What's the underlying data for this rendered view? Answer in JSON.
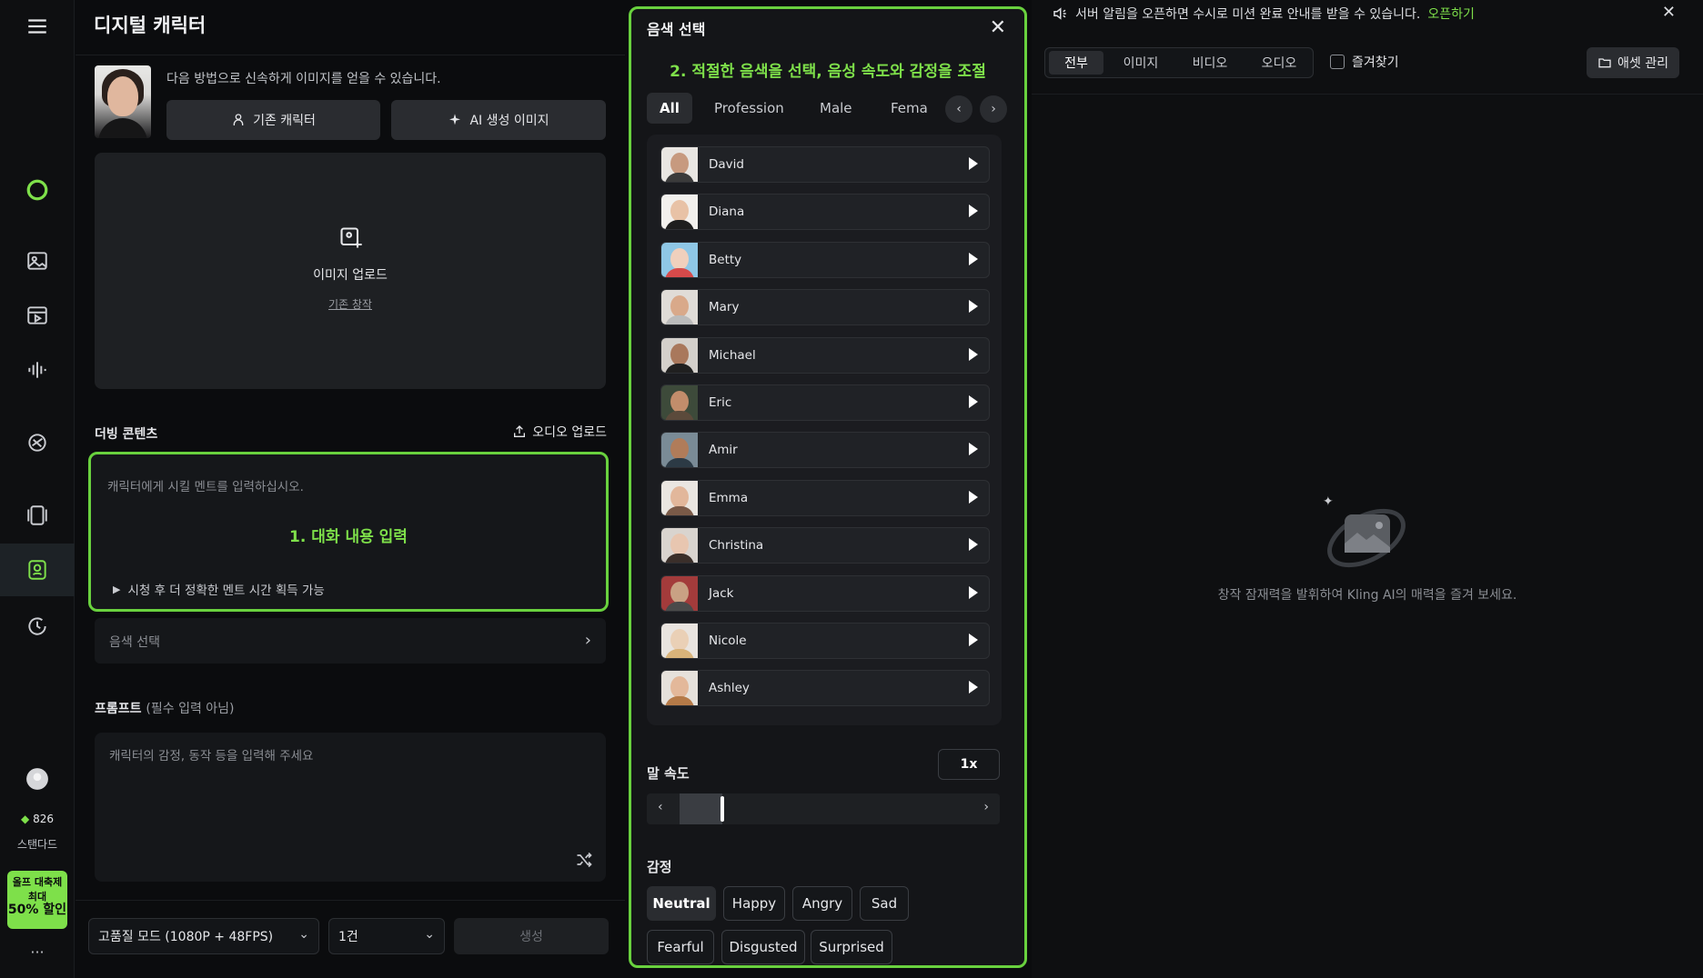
{
  "rail": {
    "credits": "826",
    "plan": "스탠다드",
    "promo": {
      "line1": "올프 대축제",
      "line2": "최대",
      "line3": "50% 할인"
    },
    "more": "···"
  },
  "left_panel": {
    "title": "디지털 캐릭터",
    "desc": "다음 방법으로 신속하게 이미지를 얻을 수 있습니다.",
    "btn_existing": "기존 캐릭터",
    "btn_ai": "AI 생성 이미지",
    "upload_label": "이미지 업로드",
    "upload_sub": "기존 창작",
    "dubbing_label": "더빙 콘텐츠",
    "audio_upload": "오디오 업로드",
    "dub_placeholder": "캐릭터에게 시킬 멘트를 입력하십시오.",
    "dub_annotation": "1. 대화 내용 입력",
    "dub_hint": "시청 후 더 정확한 멘트 시간 획득 가능",
    "voice_select": "음색 선택",
    "prompt_label": "프롬프트",
    "prompt_optional": "(필수 입력 아님)",
    "prompt_placeholder": "캐릭터의 감정, 동작 등을 입력해 주세요",
    "quality_select": "고품질 모드 (1080P + 48FPS)",
    "count_select": "1건",
    "generate": "생성"
  },
  "voice_modal": {
    "title": "음색 선택",
    "annotation": "2. 적절한 음색을 선택, 음성 속도와 감정을 조절",
    "tabs": [
      "All",
      "Profession",
      "Male",
      "Fema"
    ],
    "voices": [
      "David",
      "Diana",
      "Betty",
      "Mary",
      "Michael",
      "Eric",
      "Amir",
      "Emma",
      "Christina",
      "Jack",
      "Nicole",
      "Ashley"
    ],
    "speed_label": "말 속도",
    "speed_value": "1x",
    "speed_level": 0.15,
    "emotion_label": "감정",
    "emotions": [
      "Neutral",
      "Happy",
      "Angry",
      "Sad",
      "Fearful",
      "Disgusted",
      "Surprised"
    ],
    "selected_emotion": "Neutral"
  },
  "right": {
    "notice": "서버 알림을 오픈하면 수시로 미션 완료 안내를 받을 수 있습니다.",
    "notice_link": "오픈하기",
    "filters": [
      "전부",
      "이미지",
      "비디오",
      "오디오"
    ],
    "favorites": "즐겨찾기",
    "asset_manage": "애셋 관리",
    "empty_text": "창작 잠재력을 발휘하여 Kling AI의 매력을 즐겨 보세요."
  },
  "colors": {
    "accent": "#7ee04a",
    "annotation_border": "#69d13e",
    "bg": "#0b0c0e"
  }
}
